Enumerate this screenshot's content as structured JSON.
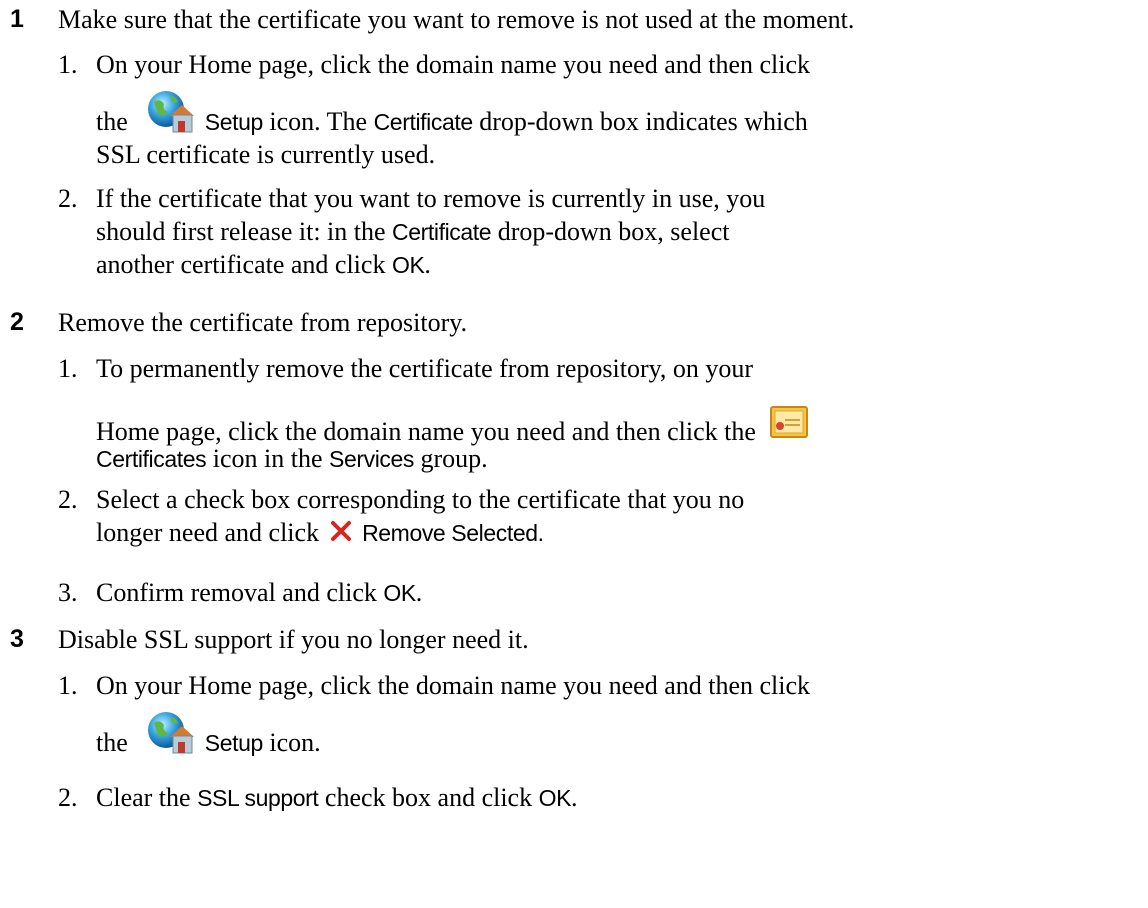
{
  "steps": [
    {
      "number": "1",
      "text": "Make sure that the certificate you want to remove is not used at the moment.",
      "substeps": [
        {
          "number": "1.",
          "line1": "On your Home page, click the domain name you need and then click",
          "line2_pre": "the",
          "icon": "setup-globe-house-icon",
          "ui1": "Setup",
          "line2_mid": "icon. The",
          "ui2": "Certificate",
          "line2_post": "drop-down box indicates which",
          "line3": "SSL certificate is currently used."
        },
        {
          "number": "2.",
          "line1": "If the certificate that you want to remove is currently in use, you",
          "line2_pre": "should first release it: in the",
          "ui1": "Certificate",
          "line2_post": "drop-down box, select",
          "line3_pre": "another certificate and click",
          "ui2": "OK",
          "line3_post": "."
        }
      ]
    },
    {
      "number": "2",
      "text": "Remove the certificate from repository.",
      "substeps": [
        {
          "number": "1.",
          "line1": "To permanently remove the certificate from repository, on your",
          "line2": "Home page, click the domain name you need and then click the",
          "icon": "certificate-icon",
          "ui1": "Certificates",
          "line3_mid": "icon in the",
          "ui2": "Services",
          "line3_post": "group."
        },
        {
          "number": "2.",
          "line1": "Select a check box corresponding to the certificate that you no",
          "line2_pre": "longer need and click",
          "icon": "remove-x-icon",
          "ui1": "Remove Selected."
        },
        {
          "number": "3.",
          "text_pre": "Confirm removal and click",
          "ui1": "OK",
          "text_post": "."
        }
      ]
    },
    {
      "number": "3",
      "text": "Disable SSL support if you no longer need it.",
      "substeps": [
        {
          "number": "1.",
          "line1": "On your Home page, click the domain name you need and then click",
          "line2_pre": "the",
          "icon": "setup-globe-house-icon",
          "ui1": "Setup",
          "line2_post": "icon."
        },
        {
          "number": "2.",
          "text_pre": "Clear the",
          "ui1": "SSL support",
          "text_mid": "check box and click",
          "ui2": "OK",
          "text_post": "."
        }
      ]
    }
  ],
  "colors": {
    "text": "#000000",
    "remove_icon": "#d9231f",
    "certificate_icon": "#f0a020"
  }
}
